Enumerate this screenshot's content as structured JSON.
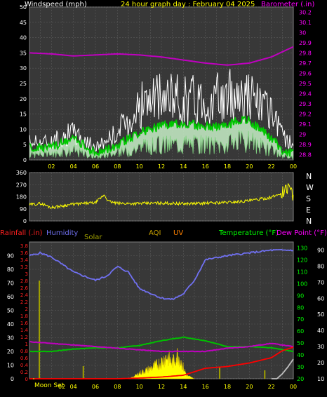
{
  "header": {
    "left": "Windspeed (mph)",
    "center": "24 hour graph day : February 04 2025",
    "right": "Barometer (.in)"
  },
  "dir_labels": [
    "N",
    "W",
    "S",
    "E",
    "N"
  ],
  "legend_bottom": {
    "rainfall": "Rainfall (.in)",
    "humidity": "Humidity",
    "solar": "Solar",
    "aqi": "AQI",
    "uv": "UV",
    "temperature": "Temperature (°F)",
    "dewpoint": "Dew Point (°F)"
  },
  "moon_label": "Moon Set",
  "colors": {
    "background": "#000000",
    "plot_bg": "#383838",
    "grid": "#5a5a5a",
    "wind_gust": "#ffffff",
    "wind_avg": "#00c800",
    "wind_fill": "#c8f0c8",
    "barometer": "#c000c0",
    "direction": "#ffff00",
    "humidity": "#7070f0",
    "temperature": "#00c000",
    "dewpoint": "#c000c0",
    "rain": "#ff0000",
    "solar": "#ffff00",
    "uv": "#c0c0c0",
    "axis_white": "#ffffff",
    "axis_green": "#00ff00",
    "axis_rain": "#ff2020",
    "header_yellow": "#ffff00",
    "header_magenta": "#ff00ff"
  },
  "chart_data": [
    {
      "type": "line",
      "title": "24 hour graph day : February 04 2025",
      "x_ticks": [
        "02",
        "04",
        "06",
        "08",
        "10",
        "12",
        "14",
        "16",
        "18",
        "20",
        "22",
        "00"
      ],
      "y_left": {
        "label": "Windspeed (mph)",
        "ticks": [
          0,
          5,
          10,
          15,
          20,
          25,
          30,
          35,
          40,
          45,
          50
        ],
        "lim": [
          0,
          50
        ]
      },
      "y_right": {
        "label": "Barometer (.in)",
        "ticks": [
          28.8,
          28.9,
          29.0,
          29.1,
          29.2,
          29.3,
          29.4,
          29.5,
          29.6,
          29.7,
          29.8,
          29.9,
          30.0,
          30.1,
          30.2
        ],
        "lim": [
          28.75,
          30.25
        ]
      },
      "series": [
        {
          "name": "Wind Gust",
          "hours": [
            0,
            2,
            4,
            6,
            8,
            9,
            10,
            12,
            14,
            16,
            18,
            19,
            20,
            21,
            22,
            23,
            24
          ],
          "values": [
            6,
            6,
            9,
            4,
            9,
            13,
            18,
            20,
            20,
            20,
            20,
            23,
            21,
            18,
            14,
            8,
            5
          ]
        },
        {
          "name": "Wind Avg",
          "hours": [
            0,
            2,
            4,
            6,
            8,
            9,
            10,
            12,
            14,
            16,
            18,
            19,
            20,
            21,
            22,
            23,
            24
          ],
          "values": [
            4,
            4,
            7,
            2,
            5,
            7,
            9,
            11,
            12,
            11,
            11,
            13,
            13,
            10,
            7,
            3,
            2
          ]
        },
        {
          "name": "Barometer",
          "hours": [
            0,
            2,
            4,
            6,
            8,
            10,
            12,
            14,
            16,
            18,
            20,
            22,
            24
          ],
          "values": [
            29.8,
            29.79,
            29.77,
            29.78,
            29.79,
            29.78,
            29.76,
            29.73,
            29.7,
            29.68,
            29.7,
            29.76,
            29.86
          ]
        }
      ]
    },
    {
      "type": "line",
      "y_ticks": [
        0,
        90,
        180,
        270,
        360
      ],
      "ylim": [
        0,
        360
      ],
      "series": [
        {
          "name": "Wind Direction",
          "hours": [
            0,
            1,
            2,
            4,
            6,
            6.8,
            7.2,
            8,
            10,
            12,
            14,
            16,
            18,
            20,
            22,
            23,
            23.5,
            24
          ],
          "values": [
            120,
            130,
            100,
            125,
            135,
            195,
            145,
            130,
            130,
            133,
            128,
            132,
            138,
            150,
            175,
            210,
            270,
            160
          ]
        }
      ]
    },
    {
      "type": "line",
      "x_ticks": [
        "02",
        "04",
        "06",
        "08",
        "10",
        "12",
        "14",
        "16",
        "18",
        "20",
        "22",
        "00"
      ],
      "y_left_humidity_ticks": [
        0,
        10,
        20,
        30,
        40,
        50,
        60,
        70,
        80,
        90
      ],
      "y_left_rain_ticks": [
        0,
        0.2,
        0.4,
        0.6,
        0.8,
        1.0,
        1.2,
        1.4,
        1.6,
        1.8,
        2.0,
        2.2,
        2.4,
        2.6,
        2.8,
        3.0,
        3.2,
        3.4,
        3.6,
        3.8
      ],
      "y_right_temp_ticks": [
        20,
        30,
        40,
        50,
        60,
        70,
        80,
        90,
        100,
        110,
        120,
        130
      ],
      "y_right_dew_ticks": [
        10,
        20,
        30,
        40,
        50,
        60,
        70,
        80,
        90
      ],
      "series": [
        {
          "name": "Humidity",
          "hours": [
            0,
            1,
            2,
            4,
            6,
            7,
            8,
            9,
            10,
            12,
            13,
            14,
            15,
            16,
            18,
            20,
            22,
            24
          ],
          "values": [
            90,
            92,
            89,
            78,
            72,
            75,
            82,
            78,
            66,
            59,
            58,
            62,
            72,
            87,
            90,
            92,
            94,
            94
          ]
        },
        {
          "name": "Temperature (°F)",
          "hours": [
            0,
            2,
            4,
            6,
            8,
            10,
            12,
            14,
            16,
            18,
            20,
            22,
            24
          ],
          "values": [
            43,
            43,
            45,
            46,
            46,
            48,
            52,
            55,
            52,
            47,
            47,
            46,
            43
          ]
        },
        {
          "name": "Dew Point (°F)",
          "hours": [
            0,
            2,
            4,
            6,
            8,
            10,
            12,
            14,
            16,
            18,
            20,
            22,
            24
          ],
          "values": [
            33,
            32,
            31,
            30,
            29,
            28,
            27,
            27,
            27,
            29,
            30,
            32,
            30
          ]
        },
        {
          "name": "Rainfall (.in)",
          "hours": [
            0,
            8,
            10,
            12,
            14,
            15,
            16,
            18,
            20,
            22,
            23,
            24
          ],
          "values": [
            0,
            0,
            0.02,
            0.05,
            0.1,
            0.2,
            0.3,
            0.35,
            0.45,
            0.6,
            0.8,
            0.9
          ]
        },
        {
          "name": "Solar",
          "hours": [
            0,
            9,
            9.5,
            10,
            11,
            12,
            12.5,
            13,
            13.5,
            14,
            14.3,
            15,
            24
          ],
          "values": [
            0,
            0,
            2,
            5,
            9,
            15,
            20,
            14,
            22,
            10,
            3,
            0,
            0
          ]
        },
        {
          "name": "UV",
          "hours": [
            0,
            22.5,
            23,
            23.5,
            24
          ],
          "values": [
            0,
            0,
            0.5,
            1.2,
            2
          ]
        }
      ]
    }
  ]
}
